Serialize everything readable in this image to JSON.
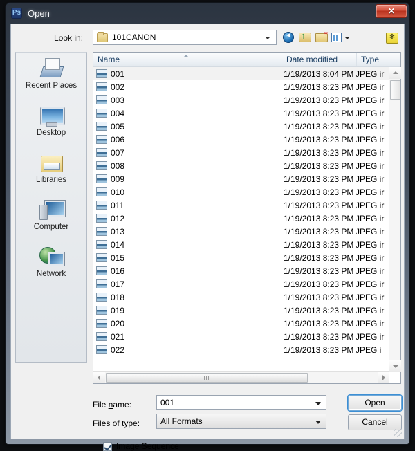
{
  "window": {
    "title": "Open",
    "app_icon": "photoshop-ps-icon",
    "close_label": "✕"
  },
  "toolbar": {
    "lookin_label_pre": "Look ",
    "lookin_label_accel": "i",
    "lookin_label_post": "n:",
    "lookin_value": "101CANON",
    "buttons": [
      {
        "name": "back-icon",
        "tooltip": "Back"
      },
      {
        "name": "up-one-level-icon",
        "tooltip": "Up One Level"
      },
      {
        "name": "new-folder-icon",
        "tooltip": "Create New Folder"
      },
      {
        "name": "views-icon",
        "tooltip": "Views"
      },
      {
        "name": "bridge-icon",
        "tooltip": "Bridge"
      }
    ]
  },
  "places": [
    {
      "label": "Recent Places",
      "icon": "recent-places-icon"
    },
    {
      "label": "Desktop",
      "icon": "desktop-icon"
    },
    {
      "label": "Libraries",
      "icon": "libraries-icon"
    },
    {
      "label": "Computer",
      "icon": "computer-icon"
    },
    {
      "label": "Network",
      "icon": "network-icon"
    }
  ],
  "list": {
    "columns": [
      {
        "label": "Name"
      },
      {
        "label": "Date modified"
      },
      {
        "label": "Type"
      }
    ],
    "sort": "ascending",
    "rows": [
      {
        "name": "001",
        "date": "1/19/2013 8:04 PM",
        "type": "JPEG ir",
        "selected": true
      },
      {
        "name": "002",
        "date": "1/19/2013 8:23 PM",
        "type": "JPEG ir",
        "selected": false
      },
      {
        "name": "003",
        "date": "1/19/2013 8:23 PM",
        "type": "JPEG ir",
        "selected": false
      },
      {
        "name": "004",
        "date": "1/19/2013 8:23 PM",
        "type": "JPEG ir",
        "selected": false
      },
      {
        "name": "005",
        "date": "1/19/2013 8:23 PM",
        "type": "JPEG ir",
        "selected": false
      },
      {
        "name": "006",
        "date": "1/19/2013 8:23 PM",
        "type": "JPEG ir",
        "selected": false
      },
      {
        "name": "007",
        "date": "1/19/2013 8:23 PM",
        "type": "JPEG ir",
        "selected": false
      },
      {
        "name": "008",
        "date": "1/19/2013 8:23 PM",
        "type": "JPEG ir",
        "selected": false
      },
      {
        "name": "009",
        "date": "1/19/2013 8:23 PM",
        "type": "JPEG ir",
        "selected": false
      },
      {
        "name": "010",
        "date": "1/19/2013 8:23 PM",
        "type": "JPEG ir",
        "selected": false
      },
      {
        "name": "011",
        "date": "1/19/2013 8:23 PM",
        "type": "JPEG ir",
        "selected": false
      },
      {
        "name": "012",
        "date": "1/19/2013 8:23 PM",
        "type": "JPEG ir",
        "selected": false
      },
      {
        "name": "013",
        "date": "1/19/2013 8:23 PM",
        "type": "JPEG ir",
        "selected": false
      },
      {
        "name": "014",
        "date": "1/19/2013 8:23 PM",
        "type": "JPEG ir",
        "selected": false
      },
      {
        "name": "015",
        "date": "1/19/2013 8:23 PM",
        "type": "JPEG ir",
        "selected": false
      },
      {
        "name": "016",
        "date": "1/19/2013 8:23 PM",
        "type": "JPEG ir",
        "selected": false
      },
      {
        "name": "017",
        "date": "1/19/2013 8:23 PM",
        "type": "JPEG ir",
        "selected": false
      },
      {
        "name": "018",
        "date": "1/19/2013 8:23 PM",
        "type": "JPEG ir",
        "selected": false
      },
      {
        "name": "019",
        "date": "1/19/2013 8:23 PM",
        "type": "JPEG ir",
        "selected": false
      },
      {
        "name": "020",
        "date": "1/19/2013 8:23 PM",
        "type": "JPEG ir",
        "selected": false
      },
      {
        "name": "021",
        "date": "1/19/2013 8:23 PM",
        "type": "JPEG ir",
        "selected": false
      },
      {
        "name": "022",
        "date": "1/19/2013 8:23 PM",
        "type": "JPEG i",
        "selected": false
      }
    ]
  },
  "form": {
    "filename_label_pre": "File ",
    "filename_label_accel": "n",
    "filename_label_post": "ame:",
    "filename_value": "001",
    "filetype_label_pre": "Files of t",
    "filetype_label_accel": "y",
    "filetype_label_post": "pe:",
    "filetype_value": "All Formats",
    "image_sequence_label": "Image Sequence",
    "image_sequence_checked": true,
    "open_label": "Open",
    "cancel_label": "Cancel"
  },
  "colors": {
    "accent": "#3d8fd4",
    "close_button": "#c0392b",
    "header_text": "#1c3f63"
  }
}
